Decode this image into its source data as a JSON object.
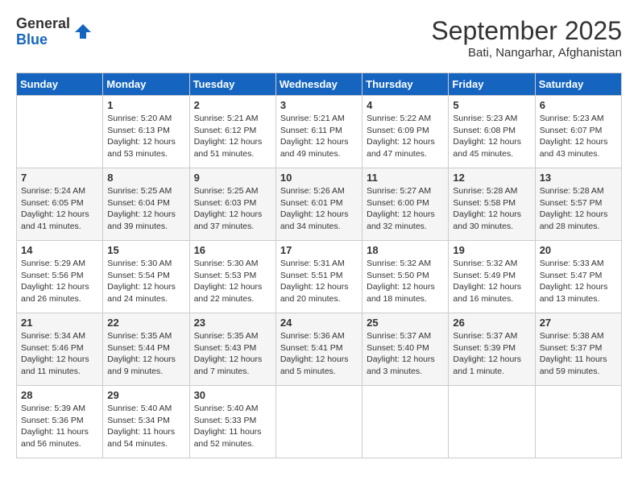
{
  "header": {
    "logo": {
      "general": "General",
      "blue": "Blue"
    },
    "title": "September 2025",
    "subtitle": "Bati, Nangarhar, Afghanistan"
  },
  "calendar": {
    "weekdays": [
      "Sunday",
      "Monday",
      "Tuesday",
      "Wednesday",
      "Thursday",
      "Friday",
      "Saturday"
    ],
    "weeks": [
      [
        {
          "day": null,
          "info": null
        },
        {
          "day": "1",
          "sunrise": "5:20 AM",
          "sunset": "6:13 PM",
          "daylight": "12 hours and 53 minutes."
        },
        {
          "day": "2",
          "sunrise": "5:21 AM",
          "sunset": "6:12 PM",
          "daylight": "12 hours and 51 minutes."
        },
        {
          "day": "3",
          "sunrise": "5:21 AM",
          "sunset": "6:11 PM",
          "daylight": "12 hours and 49 minutes."
        },
        {
          "day": "4",
          "sunrise": "5:22 AM",
          "sunset": "6:09 PM",
          "daylight": "12 hours and 47 minutes."
        },
        {
          "day": "5",
          "sunrise": "5:23 AM",
          "sunset": "6:08 PM",
          "daylight": "12 hours and 45 minutes."
        },
        {
          "day": "6",
          "sunrise": "5:23 AM",
          "sunset": "6:07 PM",
          "daylight": "12 hours and 43 minutes."
        }
      ],
      [
        {
          "day": "7",
          "sunrise": "5:24 AM",
          "sunset": "6:05 PM",
          "daylight": "12 hours and 41 minutes."
        },
        {
          "day": "8",
          "sunrise": "5:25 AM",
          "sunset": "6:04 PM",
          "daylight": "12 hours and 39 minutes."
        },
        {
          "day": "9",
          "sunrise": "5:25 AM",
          "sunset": "6:03 PM",
          "daylight": "12 hours and 37 minutes."
        },
        {
          "day": "10",
          "sunrise": "5:26 AM",
          "sunset": "6:01 PM",
          "daylight": "12 hours and 34 minutes."
        },
        {
          "day": "11",
          "sunrise": "5:27 AM",
          "sunset": "6:00 PM",
          "daylight": "12 hours and 32 minutes."
        },
        {
          "day": "12",
          "sunrise": "5:28 AM",
          "sunset": "5:58 PM",
          "daylight": "12 hours and 30 minutes."
        },
        {
          "day": "13",
          "sunrise": "5:28 AM",
          "sunset": "5:57 PM",
          "daylight": "12 hours and 28 minutes."
        }
      ],
      [
        {
          "day": "14",
          "sunrise": "5:29 AM",
          "sunset": "5:56 PM",
          "daylight": "12 hours and 26 minutes."
        },
        {
          "day": "15",
          "sunrise": "5:30 AM",
          "sunset": "5:54 PM",
          "daylight": "12 hours and 24 minutes."
        },
        {
          "day": "16",
          "sunrise": "5:30 AM",
          "sunset": "5:53 PM",
          "daylight": "12 hours and 22 minutes."
        },
        {
          "day": "17",
          "sunrise": "5:31 AM",
          "sunset": "5:51 PM",
          "daylight": "12 hours and 20 minutes."
        },
        {
          "day": "18",
          "sunrise": "5:32 AM",
          "sunset": "5:50 PM",
          "daylight": "12 hours and 18 minutes."
        },
        {
          "day": "19",
          "sunrise": "5:32 AM",
          "sunset": "5:49 PM",
          "daylight": "12 hours and 16 minutes."
        },
        {
          "day": "20",
          "sunrise": "5:33 AM",
          "sunset": "5:47 PM",
          "daylight": "12 hours and 13 minutes."
        }
      ],
      [
        {
          "day": "21",
          "sunrise": "5:34 AM",
          "sunset": "5:46 PM",
          "daylight": "12 hours and 11 minutes."
        },
        {
          "day": "22",
          "sunrise": "5:35 AM",
          "sunset": "5:44 PM",
          "daylight": "12 hours and 9 minutes."
        },
        {
          "day": "23",
          "sunrise": "5:35 AM",
          "sunset": "5:43 PM",
          "daylight": "12 hours and 7 minutes."
        },
        {
          "day": "24",
          "sunrise": "5:36 AM",
          "sunset": "5:41 PM",
          "daylight": "12 hours and 5 minutes."
        },
        {
          "day": "25",
          "sunrise": "5:37 AM",
          "sunset": "5:40 PM",
          "daylight": "12 hours and 3 minutes."
        },
        {
          "day": "26",
          "sunrise": "5:37 AM",
          "sunset": "5:39 PM",
          "daylight": "12 hours and 1 minute."
        },
        {
          "day": "27",
          "sunrise": "5:38 AM",
          "sunset": "5:37 PM",
          "daylight": "11 hours and 59 minutes."
        }
      ],
      [
        {
          "day": "28",
          "sunrise": "5:39 AM",
          "sunset": "5:36 PM",
          "daylight": "11 hours and 56 minutes."
        },
        {
          "day": "29",
          "sunrise": "5:40 AM",
          "sunset": "5:34 PM",
          "daylight": "11 hours and 54 minutes."
        },
        {
          "day": "30",
          "sunrise": "5:40 AM",
          "sunset": "5:33 PM",
          "daylight": "11 hours and 52 minutes."
        },
        {
          "day": null,
          "info": null
        },
        {
          "day": null,
          "info": null
        },
        {
          "day": null,
          "info": null
        },
        {
          "day": null,
          "info": null
        }
      ]
    ]
  }
}
